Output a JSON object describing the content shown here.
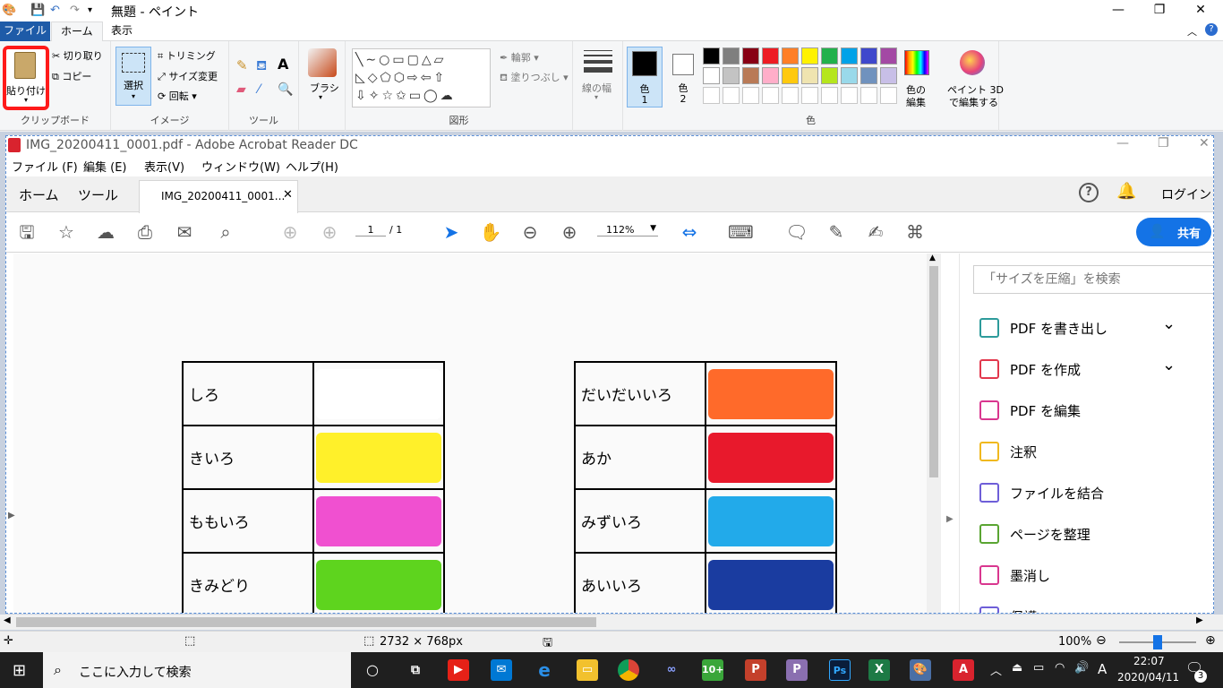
{
  "paint": {
    "title": "無題 - ペイント",
    "tabs": {
      "file": "ファイル",
      "home": "ホーム",
      "view": "表示"
    },
    "clipboard": {
      "paste": "貼り付け",
      "cut": "切り取り",
      "copy": "コピー",
      "label": "クリップボード"
    },
    "image": {
      "select": "選択",
      "crop": "トリミング",
      "resize": "サイズ変更",
      "rotate": "回転",
      "label": "イメージ"
    },
    "tools": {
      "label": "ツール"
    },
    "brush": {
      "label": "ブラシ"
    },
    "shapes": {
      "outline": "輪郭",
      "fill": "塗りつぶし",
      "label": "図形"
    },
    "size": {
      "label": "線の幅"
    },
    "colors": {
      "color1": "色\n1",
      "color1_a": "色",
      "color1_b": "1",
      "color2_a": "色",
      "color2_b": "2",
      "edit_a": "色の",
      "edit_b": "編集",
      "label": "色"
    },
    "paint3d": {
      "a": "ペイント 3D",
      "b": "で編集する"
    },
    "palette": [
      "#000000",
      "#7f7f7f",
      "#880015",
      "#ed1c24",
      "#ff7f27",
      "#fff200",
      "#22b14c",
      "#00a2e8",
      "#3f48cc",
      "#a349a4",
      "#ffffff",
      "#c3c3c3",
      "#b97a57",
      "#ffaec9",
      "#ffc90e",
      "#efe4b0",
      "#b5e61d",
      "#99d9ea",
      "#7092be",
      "#c8bfe7"
    ],
    "status": {
      "dimensions": "2732 × 768px",
      "zoom": "100%"
    }
  },
  "acrobat": {
    "title": "IMG_20200411_0001.pdf - Adobe Acrobat Reader DC",
    "menu": [
      "ファイル (F)",
      "編集 (E)",
      "表示(V)",
      "ウィンドウ(W)",
      "ヘルプ(H)"
    ],
    "tabs": {
      "home": "ホーム",
      "tools": "ツール",
      "doc": "IMG_20200411_0001...",
      "login": "ログイン"
    },
    "page": {
      "current": "1",
      "total": "/ 1"
    },
    "zoom": "112%",
    "share": "共有",
    "search_placeholder": "「サイズを圧縮」を検索",
    "panel": [
      {
        "label": "PDF を書き出し",
        "color": "#2d9b9b"
      },
      {
        "label": "PDF を作成",
        "color": "#e2384d"
      },
      {
        "label": "PDF を編集",
        "color": "#d9378f"
      },
      {
        "label": "注釈",
        "color": "#f0b81e"
      },
      {
        "label": "ファイルを結合",
        "color": "#6e5ed8"
      },
      {
        "label": "ページを整理",
        "color": "#5aa532"
      },
      {
        "label": "墨消し",
        "color": "#d9378f"
      },
      {
        "label": "保護",
        "color": "#6e5ed8"
      }
    ],
    "left_table": [
      {
        "label": "しろ",
        "color": "#ffffff"
      },
      {
        "label": "きいろ",
        "color": "#fff02a"
      },
      {
        "label": "ももいろ",
        "color": "#f050d0"
      },
      {
        "label": "きみどり",
        "color": "#5ed41e"
      }
    ],
    "right_table": [
      {
        "label": "だいだいいろ",
        "color": "#ff6a2a"
      },
      {
        "label": "あか",
        "color": "#e8192c"
      },
      {
        "label": "みずいろ",
        "color": "#22aaea"
      },
      {
        "label": "あいいろ",
        "color": "#1a3ca0"
      }
    ]
  },
  "taskbar": {
    "search_placeholder": "ここに入力して検索",
    "time": "22:07",
    "date": "2020/04/11",
    "ime": "A",
    "notifications": "3"
  }
}
